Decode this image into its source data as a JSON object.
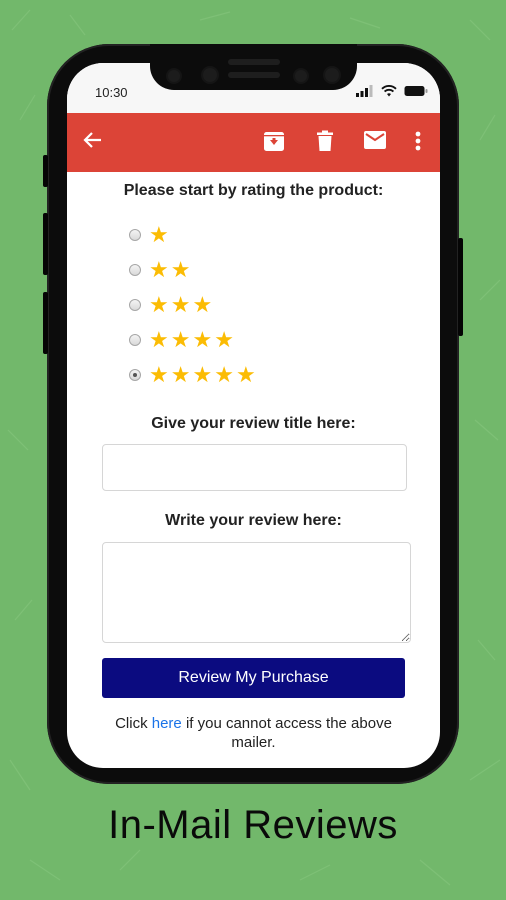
{
  "status_bar": {
    "time": "10:30",
    "icons": [
      "cellular-signal-icon",
      "wifi-icon",
      "battery-icon"
    ]
  },
  "app_bar": {
    "color": "#dc4437",
    "left_icon": "back-arrow-icon",
    "right_icons": [
      "archive-icon",
      "delete-icon",
      "mark-unread-icon",
      "more-vert-icon"
    ]
  },
  "form": {
    "rating_label": "Please start by rating the product:",
    "rating_options": [
      {
        "stars": 1,
        "checked": false
      },
      {
        "stars": 2,
        "checked": false
      },
      {
        "stars": 3,
        "checked": false
      },
      {
        "stars": 4,
        "checked": false
      },
      {
        "stars": 5,
        "checked": true
      }
    ],
    "selected_rating": 5,
    "star_color": "#fbbc04",
    "title_label": "Give your review title here:",
    "title_value": "",
    "review_label": "Write your review here:",
    "review_value": "",
    "submit_label": "Review My Purchase",
    "submit_color": "#0b0b80",
    "footnote_before": "Click ",
    "footnote_link": "here",
    "footnote_after": " if you cannot access the above mailer."
  },
  "caption": "In-Mail Reviews",
  "background_color": "#72b86b"
}
